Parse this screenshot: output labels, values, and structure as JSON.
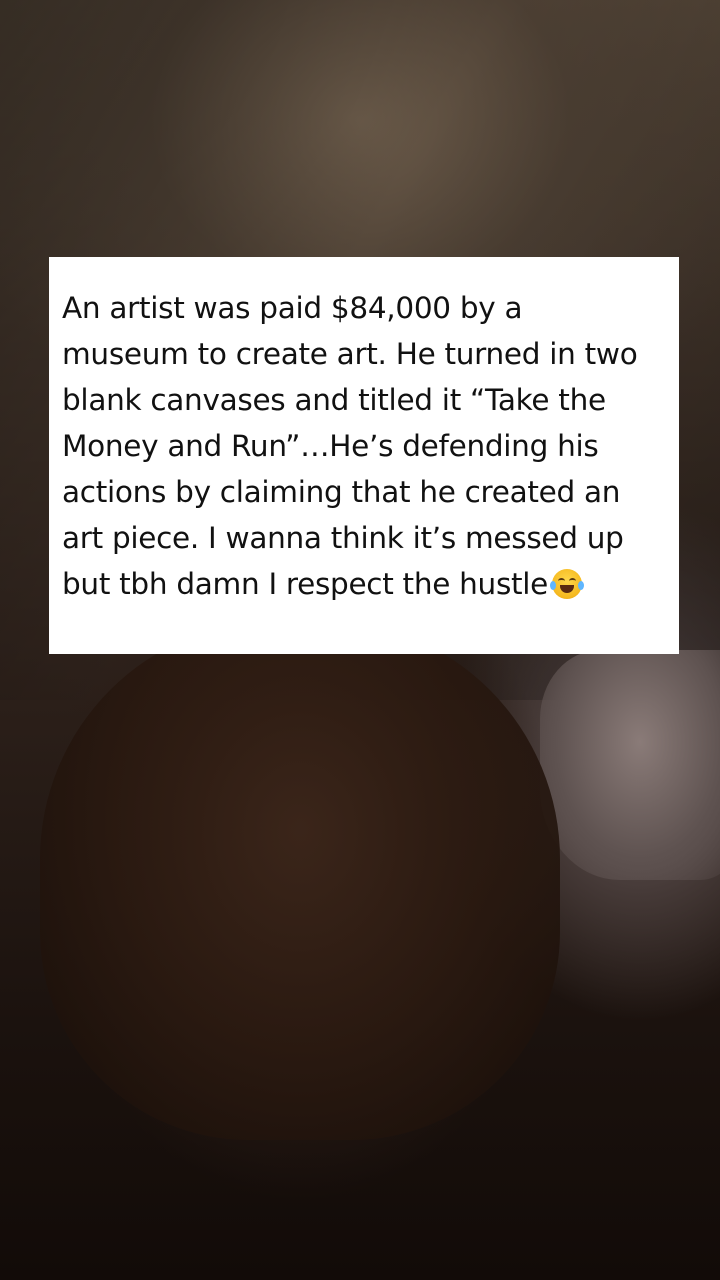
{
  "post": {
    "text": "An artist was paid $84,000 by a\nmuseum to create art. He turned in two\nblank canvases and titled it “Take the\nMoney and Run”…He’s defending his\nactions by claiming that he created an\nart piece. I wanna think it’s messed up\nbut tbh damn I respect the hustle",
    "emoji": "face-with-tears-of-joy-icon"
  },
  "colors": {
    "card_background": "#ffffff",
    "text": "#111111"
  }
}
